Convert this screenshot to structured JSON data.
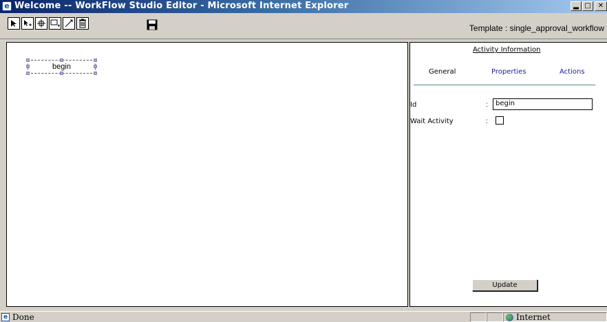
{
  "window": {
    "title": "Welcome -- WorkFlow Studio Editor - Microsoft Internet Explorer",
    "buttons": [
      "minimize",
      "maximize",
      "close"
    ]
  },
  "toolbar": {
    "tools": [
      "select-arrow-icon",
      "add-activity-arrow-icon",
      "move-icon",
      "add-node-icon",
      "connect-icon",
      "delete-icon"
    ],
    "save_icon": "floppy-disk-icon",
    "template_label": "Template : single_approval_workflow"
  },
  "canvas": {
    "activity_label": "begin"
  },
  "panel": {
    "title": "Activity Information",
    "tabs": [
      "General",
      "Properties",
      "Actions"
    ],
    "fields": {
      "id_label": "Id",
      "id_value": "begin",
      "wait_label": "Wait Activity",
      "wait_checked": false,
      "colon": ":"
    },
    "update_label": "Update"
  },
  "status": {
    "text": "Done",
    "zone": "Internet"
  },
  "colors": {
    "title_gradient_start": "#0a246a",
    "tab_link": "#1a1aa8",
    "tab_underline": "#4c8a8a"
  }
}
